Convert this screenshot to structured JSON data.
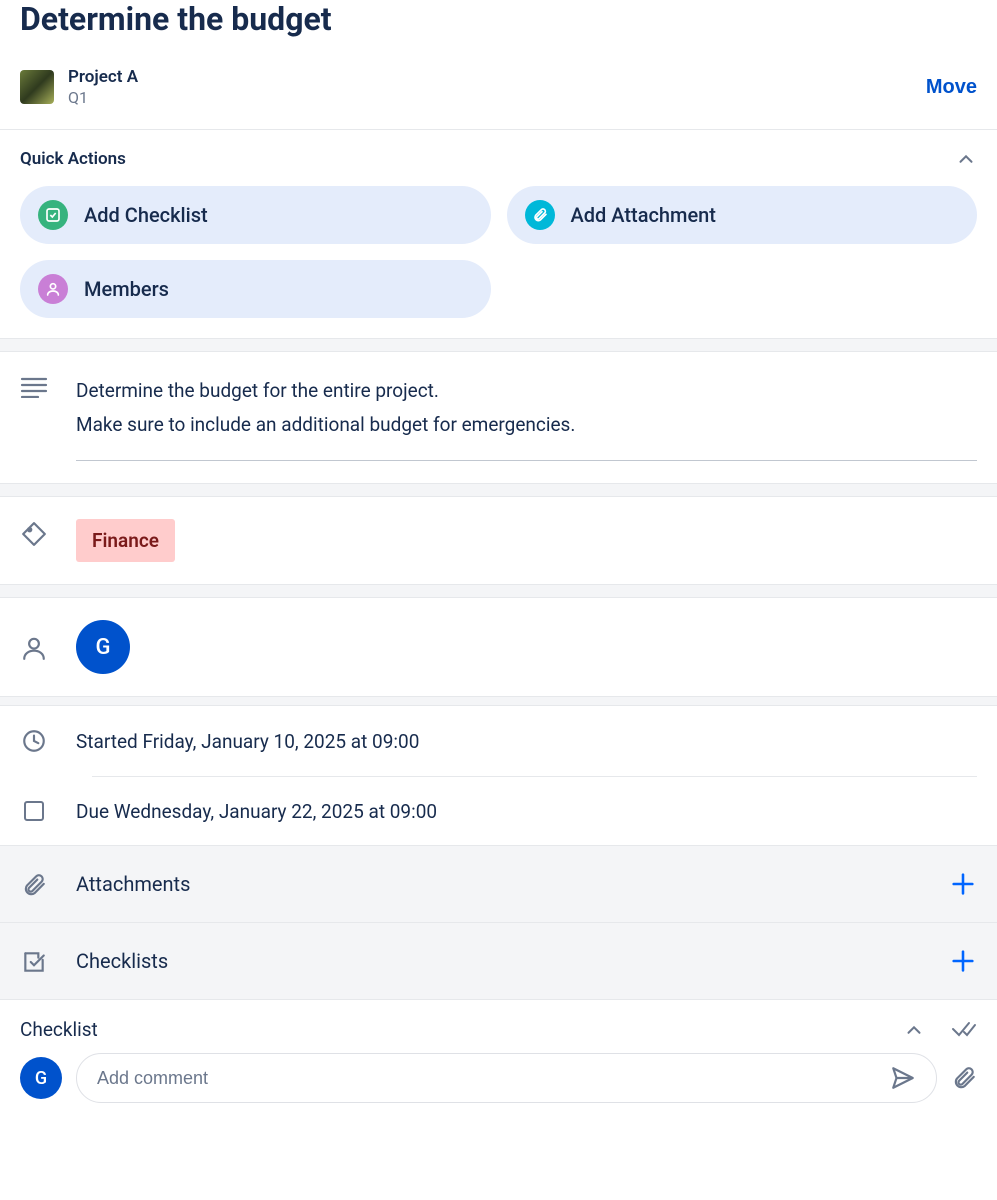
{
  "card": {
    "title": "Determine the budget",
    "project_name": "Project A",
    "project_sub": "Q1",
    "move_label": "Move"
  },
  "quick_actions": {
    "title": "Quick Actions",
    "items": [
      {
        "label": "Add Checklist"
      },
      {
        "label": "Add Attachment"
      },
      {
        "label": "Members"
      }
    ]
  },
  "description": {
    "line1": "Determine the budget for the entire project.",
    "line2": "Make sure to include an additional budget for emergencies."
  },
  "tag": {
    "label": "Finance"
  },
  "member": {
    "initial": "G"
  },
  "dates": {
    "started": "Started Friday, January 10, 2025 at 09:00",
    "due": "Due Wednesday, January 22, 2025 at 09:00"
  },
  "sections": {
    "attachments": "Attachments",
    "checklists": "Checklists",
    "checklist_single": "Checklist"
  },
  "comment": {
    "avatar_initial": "G",
    "placeholder": "Add comment"
  }
}
